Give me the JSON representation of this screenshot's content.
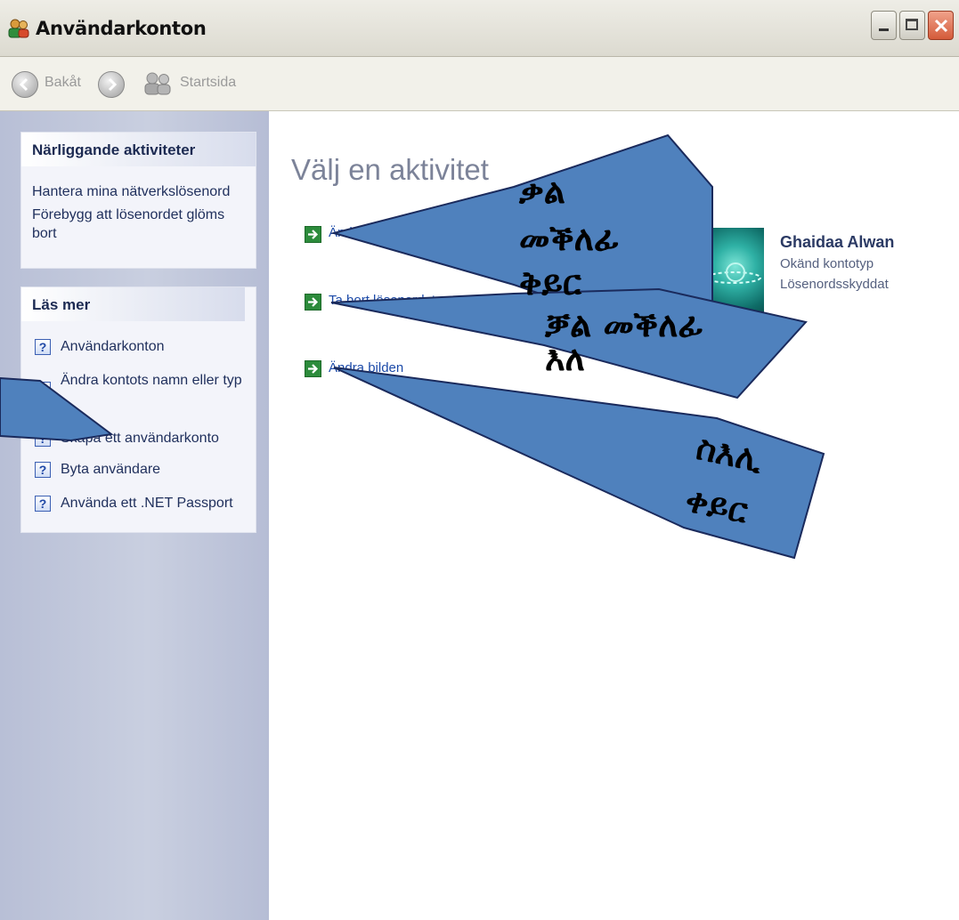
{
  "window": {
    "title": "Användarkonton"
  },
  "toolbar": {
    "back_label": "Bakåt",
    "home_label": "Startsida"
  },
  "sidebar": {
    "related": {
      "header": "Närliggande aktiviteter",
      "links": [
        "Hantera mina nätverkslösenord",
        "Förebygg att lösenordet glöms bort"
      ]
    },
    "learn_more": {
      "header": "Läs mer",
      "items": [
        "Användarkonton",
        "Ändra kontots namn eller typ",
        "Skapa ett användarkonto",
        "Byta användare",
        "Använda ett .NET Passport"
      ]
    }
  },
  "main": {
    "title": "Välj en aktivitet",
    "tasks": [
      "Ändra",
      "Ta bort lösenordet",
      "Ändra bilden"
    ],
    "user": {
      "name": "Ghaidaa Alwan",
      "type": "Okänd kontotyp",
      "status": "Lösenordsskyddat"
    }
  },
  "callouts": {
    "c1_line1": "ቃል",
    "c1_line2": "መቕለፊ",
    "c1_line3": "ቅይር",
    "c2_line1": "ቓል መቕለፊ",
    "c2_line2": "እለ",
    "c3_line1": "ስእሊ",
    "c3_line2": "ቀይር"
  },
  "colors": {
    "callout_fill": "#4f81bd",
    "sidebar_bg": "#c3c9dc",
    "title_accent": "#7c8399"
  }
}
